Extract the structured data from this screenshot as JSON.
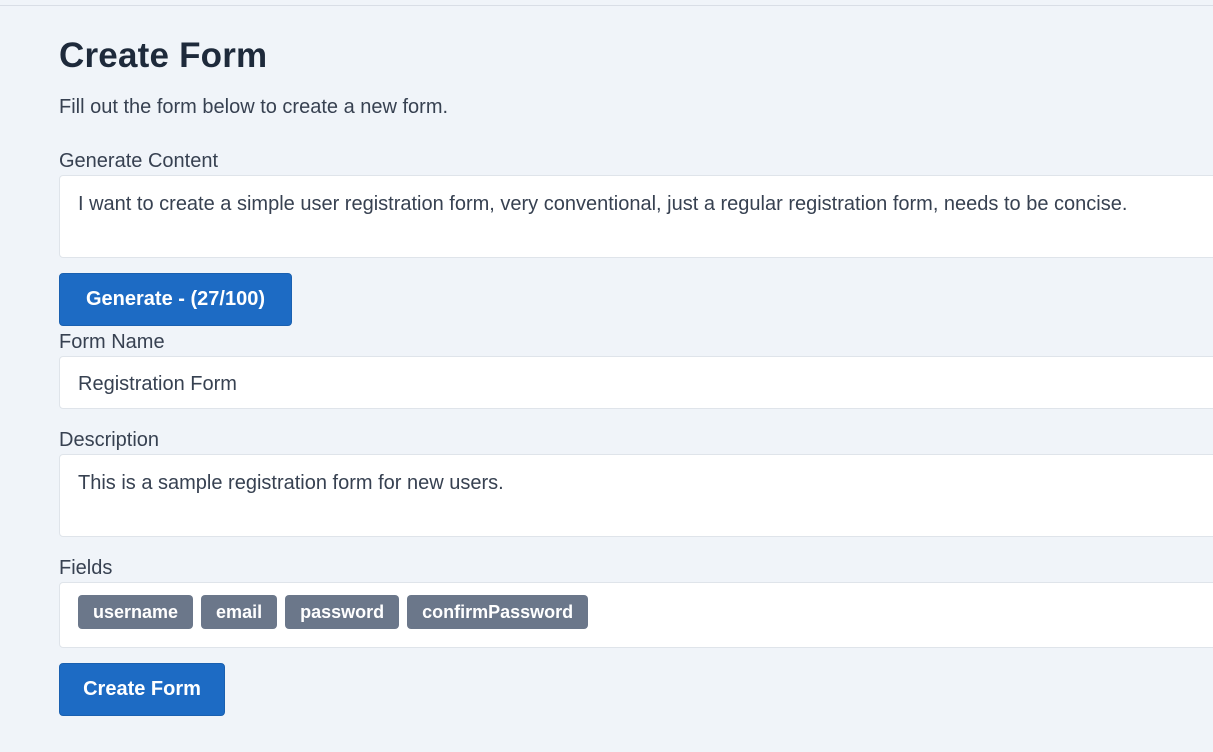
{
  "header": {
    "title": "Create Form",
    "subtitle": "Fill out the form below to create a new form."
  },
  "generate": {
    "label": "Generate Content",
    "value": "I want to create a simple user registration form, very conventional, just a regular registration form, needs to be concise.",
    "button_label": "Generate - (27/100)"
  },
  "form_name": {
    "label": "Form Name",
    "value": "Registration Form"
  },
  "description": {
    "label": "Description",
    "value": "This is a sample registration form for new users."
  },
  "fields": {
    "label": "Fields",
    "items": [
      "username",
      "email",
      "password",
      "confirmPassword"
    ]
  },
  "actions": {
    "create_label": "Create Form"
  },
  "colors": {
    "background": "#f0f4f9",
    "primary_button": "#1d6bc4",
    "chip": "#6b778a"
  }
}
